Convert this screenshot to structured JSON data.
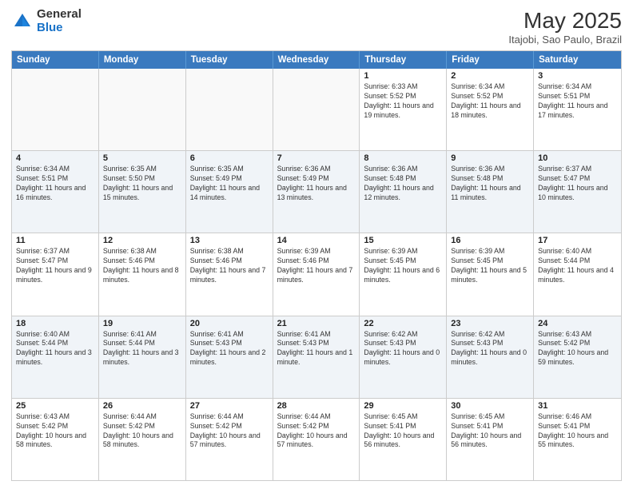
{
  "logo": {
    "general": "General",
    "blue": "Blue"
  },
  "header": {
    "month": "May 2025",
    "location": "Itajobi, Sao Paulo, Brazil"
  },
  "weekdays": [
    "Sunday",
    "Monday",
    "Tuesday",
    "Wednesday",
    "Thursday",
    "Friday",
    "Saturday"
  ],
  "rows": [
    [
      {
        "day": "",
        "content": "",
        "empty": true
      },
      {
        "day": "",
        "content": "",
        "empty": true
      },
      {
        "day": "",
        "content": "",
        "empty": true
      },
      {
        "day": "",
        "content": "",
        "empty": true
      },
      {
        "day": "1",
        "content": "Sunrise: 6:33 AM\nSunset: 5:52 PM\nDaylight: 11 hours and 19 minutes."
      },
      {
        "day": "2",
        "content": "Sunrise: 6:34 AM\nSunset: 5:52 PM\nDaylight: 11 hours and 18 minutes."
      },
      {
        "day": "3",
        "content": "Sunrise: 6:34 AM\nSunset: 5:51 PM\nDaylight: 11 hours and 17 minutes."
      }
    ],
    [
      {
        "day": "4",
        "content": "Sunrise: 6:34 AM\nSunset: 5:51 PM\nDaylight: 11 hours and 16 minutes."
      },
      {
        "day": "5",
        "content": "Sunrise: 6:35 AM\nSunset: 5:50 PM\nDaylight: 11 hours and 15 minutes."
      },
      {
        "day": "6",
        "content": "Sunrise: 6:35 AM\nSunset: 5:49 PM\nDaylight: 11 hours and 14 minutes."
      },
      {
        "day": "7",
        "content": "Sunrise: 6:36 AM\nSunset: 5:49 PM\nDaylight: 11 hours and 13 minutes."
      },
      {
        "day": "8",
        "content": "Sunrise: 6:36 AM\nSunset: 5:48 PM\nDaylight: 11 hours and 12 minutes."
      },
      {
        "day": "9",
        "content": "Sunrise: 6:36 AM\nSunset: 5:48 PM\nDaylight: 11 hours and 11 minutes."
      },
      {
        "day": "10",
        "content": "Sunrise: 6:37 AM\nSunset: 5:47 PM\nDaylight: 11 hours and 10 minutes."
      }
    ],
    [
      {
        "day": "11",
        "content": "Sunrise: 6:37 AM\nSunset: 5:47 PM\nDaylight: 11 hours and 9 minutes."
      },
      {
        "day": "12",
        "content": "Sunrise: 6:38 AM\nSunset: 5:46 PM\nDaylight: 11 hours and 8 minutes."
      },
      {
        "day": "13",
        "content": "Sunrise: 6:38 AM\nSunset: 5:46 PM\nDaylight: 11 hours and 7 minutes."
      },
      {
        "day": "14",
        "content": "Sunrise: 6:39 AM\nSunset: 5:46 PM\nDaylight: 11 hours and 7 minutes."
      },
      {
        "day": "15",
        "content": "Sunrise: 6:39 AM\nSunset: 5:45 PM\nDaylight: 11 hours and 6 minutes."
      },
      {
        "day": "16",
        "content": "Sunrise: 6:39 AM\nSunset: 5:45 PM\nDaylight: 11 hours and 5 minutes."
      },
      {
        "day": "17",
        "content": "Sunrise: 6:40 AM\nSunset: 5:44 PM\nDaylight: 11 hours and 4 minutes."
      }
    ],
    [
      {
        "day": "18",
        "content": "Sunrise: 6:40 AM\nSunset: 5:44 PM\nDaylight: 11 hours and 3 minutes."
      },
      {
        "day": "19",
        "content": "Sunrise: 6:41 AM\nSunset: 5:44 PM\nDaylight: 11 hours and 3 minutes."
      },
      {
        "day": "20",
        "content": "Sunrise: 6:41 AM\nSunset: 5:43 PM\nDaylight: 11 hours and 2 minutes."
      },
      {
        "day": "21",
        "content": "Sunrise: 6:41 AM\nSunset: 5:43 PM\nDaylight: 11 hours and 1 minute."
      },
      {
        "day": "22",
        "content": "Sunrise: 6:42 AM\nSunset: 5:43 PM\nDaylight: 11 hours and 0 minutes."
      },
      {
        "day": "23",
        "content": "Sunrise: 6:42 AM\nSunset: 5:43 PM\nDaylight: 11 hours and 0 minutes."
      },
      {
        "day": "24",
        "content": "Sunrise: 6:43 AM\nSunset: 5:42 PM\nDaylight: 10 hours and 59 minutes."
      }
    ],
    [
      {
        "day": "25",
        "content": "Sunrise: 6:43 AM\nSunset: 5:42 PM\nDaylight: 10 hours and 58 minutes."
      },
      {
        "day": "26",
        "content": "Sunrise: 6:44 AM\nSunset: 5:42 PM\nDaylight: 10 hours and 58 minutes."
      },
      {
        "day": "27",
        "content": "Sunrise: 6:44 AM\nSunset: 5:42 PM\nDaylight: 10 hours and 57 minutes."
      },
      {
        "day": "28",
        "content": "Sunrise: 6:44 AM\nSunset: 5:42 PM\nDaylight: 10 hours and 57 minutes."
      },
      {
        "day": "29",
        "content": "Sunrise: 6:45 AM\nSunset: 5:41 PM\nDaylight: 10 hours and 56 minutes."
      },
      {
        "day": "30",
        "content": "Sunrise: 6:45 AM\nSunset: 5:41 PM\nDaylight: 10 hours and 56 minutes."
      },
      {
        "day": "31",
        "content": "Sunrise: 6:46 AM\nSunset: 5:41 PM\nDaylight: 10 hours and 55 minutes."
      }
    ]
  ]
}
